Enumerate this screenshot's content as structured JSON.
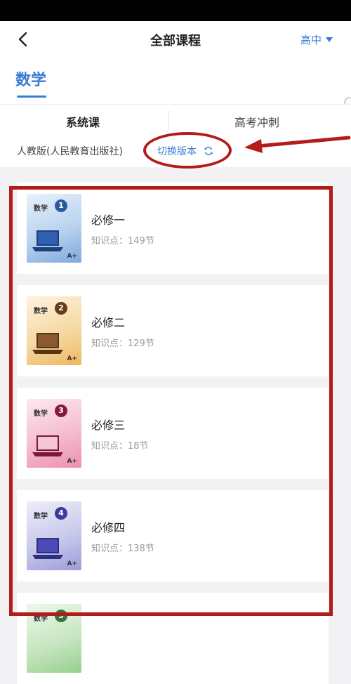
{
  "header": {
    "title": "全部课程",
    "grade": "高中"
  },
  "subject": {
    "name": "数学"
  },
  "tabs": [
    {
      "label": "系统课",
      "active": true
    },
    {
      "label": "高考冲刺",
      "active": false
    }
  ],
  "version": {
    "name": "人教版(人民教育出版社)",
    "switch_label": "切换版本"
  },
  "books": [
    {
      "title": "必修一",
      "points": "知识点：149节",
      "cover_tag": "数学",
      "cover_num": "1",
      "cover_color": "#2c5aa0",
      "cover_bg": "#d6e6f6",
      "aplus": "A+"
    },
    {
      "title": "必修二",
      "points": "知识点：129节",
      "cover_tag": "数学",
      "cover_num": "2",
      "cover_color": "#6b3b1a",
      "cover_bg": "#f7e6c8",
      "aplus": "A+"
    },
    {
      "title": "必修三",
      "points": "知识点：18节",
      "cover_tag": "数学",
      "cover_num": "3",
      "cover_color": "#8b1a3a",
      "cover_bg": "#f8d6e2",
      "aplus": "A+"
    },
    {
      "title": "必修四",
      "points": "知识点：138节",
      "cover_tag": "数学",
      "cover_num": "4",
      "cover_color": "#3a3a9a",
      "cover_bg": "#dcdcf2",
      "aplus": "A+"
    },
    {
      "title": "",
      "points": "",
      "cover_tag": "数学",
      "cover_num": "5",
      "cover_color": "#2f7a3a",
      "cover_bg": "#dcefd8",
      "aplus": ""
    }
  ],
  "colors": {
    "accent": "#3a7bd5",
    "annotation": "#b41c1c"
  }
}
